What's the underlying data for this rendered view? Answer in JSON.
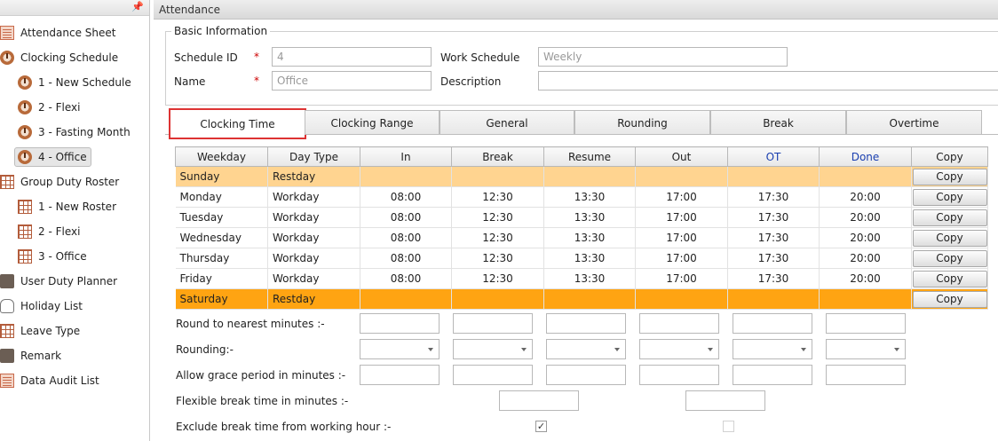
{
  "sidebar": {
    "pin_icon": "pin-icon",
    "items": [
      {
        "label": "Attendance Sheet",
        "icon": "sheet",
        "level": 0
      },
      {
        "label": "Clocking Schedule",
        "icon": "clock",
        "level": 0
      },
      {
        "label": "1 - New Schedule",
        "icon": "clock",
        "level": 1
      },
      {
        "label": "2 - Flexi",
        "icon": "clock",
        "level": 1
      },
      {
        "label": "3 - Fasting Month",
        "icon": "clock",
        "level": 1
      },
      {
        "label": "4 - Office",
        "icon": "clock",
        "level": 1,
        "selected": true
      },
      {
        "label": "Group Duty Roster",
        "icon": "grid",
        "level": 0
      },
      {
        "label": "1 - New Roster",
        "icon": "grid",
        "level": 1
      },
      {
        "label": "2 - Flexi",
        "icon": "grid",
        "level": 1
      },
      {
        "label": "3 - Office",
        "icon": "grid",
        "level": 1
      },
      {
        "label": "User Duty Planner",
        "icon": "briefcase",
        "level": 0
      },
      {
        "label": "Holiday List",
        "icon": "flipflops",
        "level": 0
      },
      {
        "label": "Leave Type",
        "icon": "grid",
        "level": 0
      },
      {
        "label": "Remark",
        "icon": "briefcase",
        "level": 0
      },
      {
        "label": "Data Audit List",
        "icon": "sheet",
        "level": 0
      }
    ]
  },
  "main": {
    "title": "Attendance",
    "basic": {
      "legend": "Basic Information",
      "schedule_id_label": "Schedule ID",
      "schedule_id_value": "4",
      "name_label": "Name",
      "name_placeholder": "Office",
      "work_schedule_label": "Work Schedule",
      "work_schedule_placeholder": "Weekly",
      "description_label": "Description",
      "required_mark": "*"
    },
    "tabs": [
      "Clocking Time",
      "Clocking Range",
      "General",
      "Rounding",
      "Break",
      "Overtime"
    ],
    "active_tab": "Clocking Time",
    "table": {
      "headers": [
        "Weekday",
        "Day Type",
        "In",
        "Break",
        "Resume",
        "Out",
        "OT",
        "Done",
        "Copy"
      ],
      "rows": [
        {
          "weekday": "Sunday",
          "daytype": "Restday",
          "in": "",
          "brk": "",
          "resume": "",
          "out": "",
          "ot": "",
          "done": "",
          "copy": "Copy",
          "style": "sun"
        },
        {
          "weekday": "Monday",
          "daytype": "Workday",
          "in": "08:00",
          "brk": "12:30",
          "resume": "13:30",
          "out": "17:00",
          "ot": "17:30",
          "done": "20:00",
          "copy": "Copy",
          "style": ""
        },
        {
          "weekday": "Tuesday",
          "daytype": "Workday",
          "in": "08:00",
          "brk": "12:30",
          "resume": "13:30",
          "out": "17:00",
          "ot": "17:30",
          "done": "20:00",
          "copy": "Copy",
          "style": ""
        },
        {
          "weekday": "Wednesday",
          "daytype": "Workday",
          "in": "08:00",
          "brk": "12:30",
          "resume": "13:30",
          "out": "17:00",
          "ot": "17:30",
          "done": "20:00",
          "copy": "Copy",
          "style": ""
        },
        {
          "weekday": "Thursday",
          "daytype": "Workday",
          "in": "08:00",
          "brk": "12:30",
          "resume": "13:30",
          "out": "17:00",
          "ot": "17:30",
          "done": "20:00",
          "copy": "Copy",
          "style": ""
        },
        {
          "weekday": "Friday",
          "daytype": "Workday",
          "in": "08:00",
          "brk": "12:30",
          "resume": "13:30",
          "out": "17:00",
          "ot": "17:30",
          "done": "20:00",
          "copy": "Copy",
          "style": ""
        },
        {
          "weekday": "Saturday",
          "daytype": "Restday",
          "in": "",
          "brk": "",
          "resume": "",
          "out": "",
          "ot": "",
          "done": "",
          "copy": "Copy",
          "style": "sat"
        }
      ]
    },
    "settings": {
      "round_nearest": "Round to nearest minutes :-",
      "rounding": "Rounding:-",
      "grace": "Allow grace period in minutes :-",
      "flex_break": "Flexible break time in minutes :-",
      "exclude_break": "Exclude break time from working hour :-",
      "check_mark": "✓"
    },
    "colors": {
      "sunday_row": "#ffd490",
      "saturday_row": "#ffa412",
      "active_tab_border": "#d33333",
      "ot_header": "#1a3fb0"
    }
  }
}
